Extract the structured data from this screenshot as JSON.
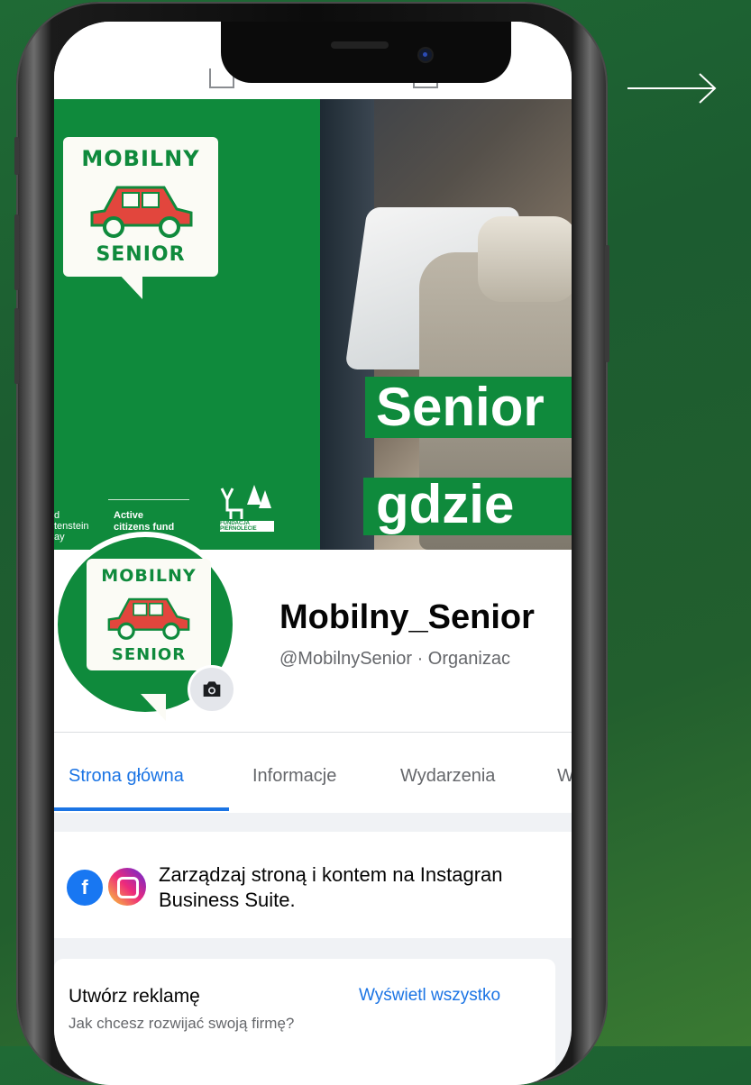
{
  "colors": {
    "accent": "#1b74e4",
    "brand_green": "#0f8a3c",
    "text_primary": "#050505",
    "text_secondary": "#65676b"
  },
  "icons": {
    "arrow": "arrow-right-icon",
    "camera": "camera-icon",
    "facebook": "facebook-icon",
    "instagram": "instagram-icon"
  },
  "cover": {
    "logo_line1": "MOBILNY",
    "logo_line2": "SENIOR",
    "slogan_line1": "Senior",
    "slogan_line2": "gdzie",
    "sponsor_left": "d\ntenstein\nay",
    "sponsor_active": "Active",
    "sponsor_citizens": "citizens fund",
    "foundation": "FUNDACJA\nPIERNOLECIE"
  },
  "profile": {
    "name": "Mobilny_Senior",
    "handle": "@MobilnySenior · Organizac"
  },
  "tabs": [
    {
      "label": "Strona główna"
    },
    {
      "label": "Informacje"
    },
    {
      "label": "Wydarzenia"
    },
    {
      "label": "W"
    }
  ],
  "suite": {
    "line1": "Zarządzaj stroną i kontem na Instagran",
    "line2": "Business Suite."
  },
  "ad": {
    "title": "Utwórz reklamę",
    "link": "Wyświetl wszystko",
    "subtitle": "Jak chcesz rozwijać swoją firmę?"
  }
}
